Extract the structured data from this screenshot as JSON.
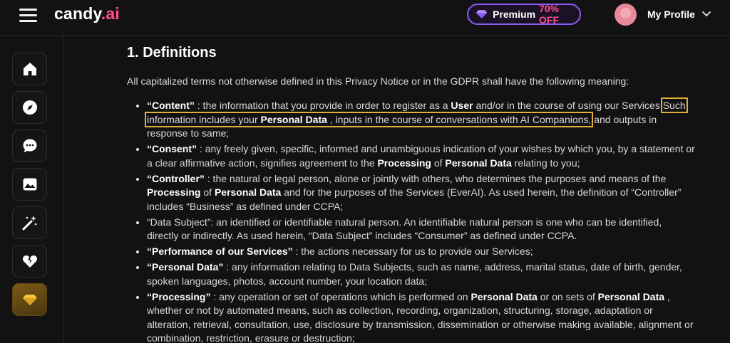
{
  "brand": {
    "name": "candy",
    "suffix": ".ai"
  },
  "premium": {
    "label": "Premium",
    "discount": "70% OFF"
  },
  "profile": {
    "label": "My Profile"
  },
  "sidebar": {
    "items": [
      {
        "icon": "home-icon"
      },
      {
        "icon": "compass-icon"
      },
      {
        "icon": "chat-icon"
      },
      {
        "icon": "gallery-icon"
      },
      {
        "icon": "magic-wand-icon"
      },
      {
        "icon": "broken-heart-icon"
      },
      {
        "icon": "diamond-icon"
      }
    ]
  },
  "content": {
    "heading": "1. Definitions",
    "intro": "All capitalized terms not otherwise defined in this Privacy Notice or in the GDPR shall have the following meaning:",
    "defs": {
      "content": {
        "term": "“Content”",
        "a": " : the information that you provide in order to register as a ",
        "b1": "User",
        "c": " and/or in the course of using our Services ",
        "hl1": "Such information includes your ",
        "b2": "Personal Data",
        "hl2": " , inputs in the course of conversations with AI Companions,",
        "d": " and outputs in response to same;"
      },
      "consent": {
        "term": "“Consent”",
        "a": " : any freely given, specific, informed and unambiguous indication of your wishes by which you, by a statement or a clear affirmative action, signifies agreement to the ",
        "b1": "Processing",
        "c": " of ",
        "b2": "Personal Data",
        "d": " relating to you;"
      },
      "controller": {
        "term": "“Controller”",
        "a": " : the natural or legal person, alone or jointly with others, who determines the purposes and means of the ",
        "b1": "Processing",
        "c": " of ",
        "b2": "Personal Data",
        "d": " and for the purposes of the Services (EverAI). As used herein, the definition of “Controller” includes “Business” as defined under CCPA;"
      },
      "data_subject": {
        "text": "“Data Subject”: an identified or identifiable natural person. An identifiable natural person is one who can be identified, directly or indirectly. As used herein, “Data Subject” includes “Consumer” as defined under CCPA."
      },
      "performance": {
        "term": "“Performance of our Services”",
        "a": " : the actions necessary for us to provide our Services;"
      },
      "personal_data": {
        "term": "“Personal Data”",
        "a": " : any information relating to Data Subjects, such as name, address, marital status, date of birth, gender, spoken languages, photos, account number, your location data;"
      },
      "processing": {
        "term": "“Processing”",
        "a": " : any operation or set of operations which is performed on ",
        "b1": "Personal Data",
        "c": " or on sets of ",
        "b2": "Personal Data",
        "d": " , whether or not by automated means, such as collection, recording, organization, structuring, storage, adaptation or alteration, retrieval, consultation, use, disclosure by transmission, dissemination or otherwise making available, alignment or combination, restriction, erasure or destruction;"
      }
    }
  },
  "colors": {
    "accent": "#ff4d8d",
    "premium_border": "#8b5cf6",
    "highlight": "#e3b13a",
    "background": "#121212"
  }
}
